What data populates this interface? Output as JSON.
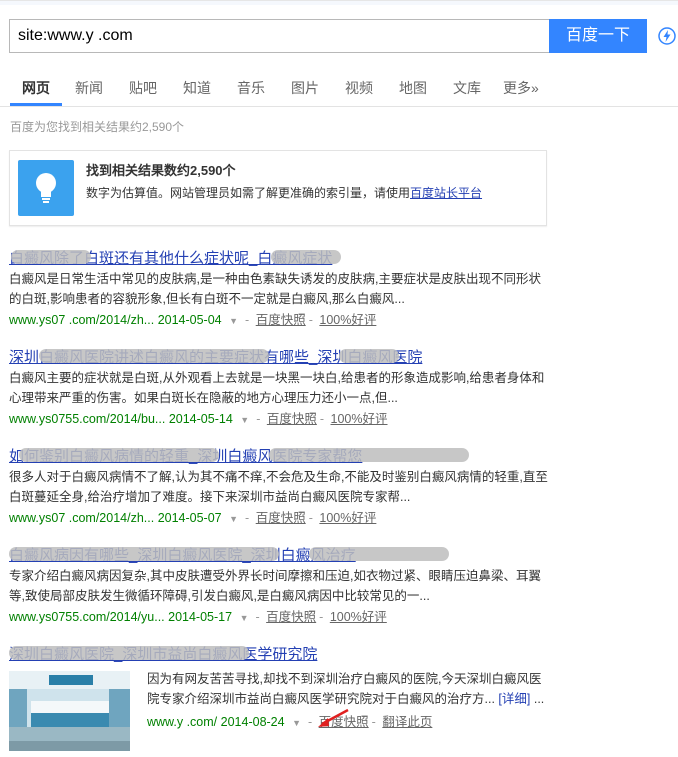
{
  "search": {
    "query": "site:www.y      .com",
    "button_label": "百度一下"
  },
  "nav": {
    "tabs": [
      "网页",
      "新闻",
      "贴吧",
      "知道",
      "音乐",
      "图片",
      "视频",
      "地图",
      "文库",
      "更多»"
    ],
    "active": "网页"
  },
  "result_count": "百度为您找到相关结果约2,590个",
  "infobox": {
    "title": "找到相关结果数约2,590个",
    "desc_prefix": "数字为估算值。网站管理员如需了解更准确的索引量，请使用",
    "desc_link": "百度站长平台"
  },
  "results": [
    {
      "title": "白癜风除了白斑还有其他什么症状呢_白癜风症状",
      "abstract": "白癜风是日常生活中常见的皮肤病,是一种由色素缺失诱发的皮肤病,主要症状是皮肤出现不同形状的白斑,影响患者的容貌形象,但长有白斑不一定就是白癜风,那么白癜风...",
      "url": "www.ys07     .com/2014/zh...",
      "date": "2014-05-04",
      "snapshot": "百度快照",
      "rating": "100%好评"
    },
    {
      "title": "深圳白癜风医院讲述白癜风的主要症状有哪些_深圳白癜风医院",
      "abstract": "白癜风主要的症状就是白斑,从外观看上去就是一块黑一块白,给患者的形象造成影响,给患者身体和心理带来严重的伤害。如果白斑长在隐蔽的地方心理压力还小一点,但...",
      "url": "www.ys0755.com/2014/bu...",
      "date": "2014-05-14",
      "snapshot": "百度快照",
      "rating": "100%好评"
    },
    {
      "title": "如何鉴别白癜风病情的轻重_深圳白癜风医院专家帮您",
      "abstract": "很多人对于白癜风病情不了解,认为其不痛不痒,不会危及生命,不能及时鉴别白癜风病情的轻重,直至白斑蔓延全身,给治疗增加了难度。接下来深圳市益尚白癜风医院专家帮...",
      "url": "www.ys07     .com/2014/zh...",
      "date": "2014-05-07",
      "snapshot": "百度快照",
      "rating": "100%好评"
    },
    {
      "title": "白癜风病因有哪些_深圳白癜风医院_深圳白癜风治疗",
      "abstract": "专家介绍白癜风病因复杂,其中皮肤遭受外界长时间摩擦和压迫,如衣物过紧、眼睛压迫鼻梁、耳翼等,致使局部皮肤发生微循环障碍,引发白癜风,是白癜风病因中比较常见的一...",
      "url": "www.ys0755.com/2014/yu...",
      "date": "2014-05-17",
      "snapshot": "百度快照",
      "rating": "100%好评"
    }
  ],
  "image_result": {
    "title": "深圳白癜风医院_深圳市益尚白癜风医学研究院",
    "abstract": "因为有网友苦苦寻找,却找不到深圳治疗白癜风的医院,今天深圳白癜风医院专家介绍深圳市益尚白癜风医学研究院对于白癜风的治疗方...",
    "detail": "[详细]",
    "tail": "...",
    "url": "www.y      .com/",
    "date": "2014-08-24",
    "snapshot": "百度快照",
    "translate": "翻译此页"
  },
  "colors": {
    "accent": "#3385ff",
    "link": "#2440b3",
    "url_green": "#008000",
    "bulb": "#3ba2ee"
  }
}
